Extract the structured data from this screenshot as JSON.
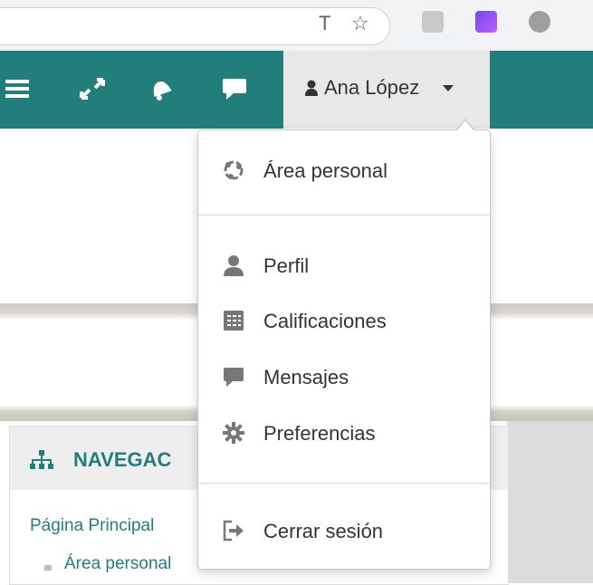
{
  "navbar": {
    "user_name": "Ana López"
  },
  "dropdown": {
    "items": [
      {
        "label": "Área personal",
        "icon": "dashboard-icon"
      },
      {
        "label": "Perfil",
        "icon": "user-icon"
      },
      {
        "label": "Calificaciones",
        "icon": "grades-table-icon"
      },
      {
        "label": "Mensajes",
        "icon": "message-icon"
      },
      {
        "label": "Preferencias",
        "icon": "gear-icon"
      },
      {
        "label": "Cerrar sesión",
        "icon": "logout-icon"
      }
    ]
  },
  "navigation_block": {
    "title": "NAVEGAC",
    "home_link": "Página Principal",
    "sub_link": "Área personal"
  },
  "colors": {
    "accent": "#227e7a",
    "user_toggle_bg": "#e8e8e8"
  }
}
